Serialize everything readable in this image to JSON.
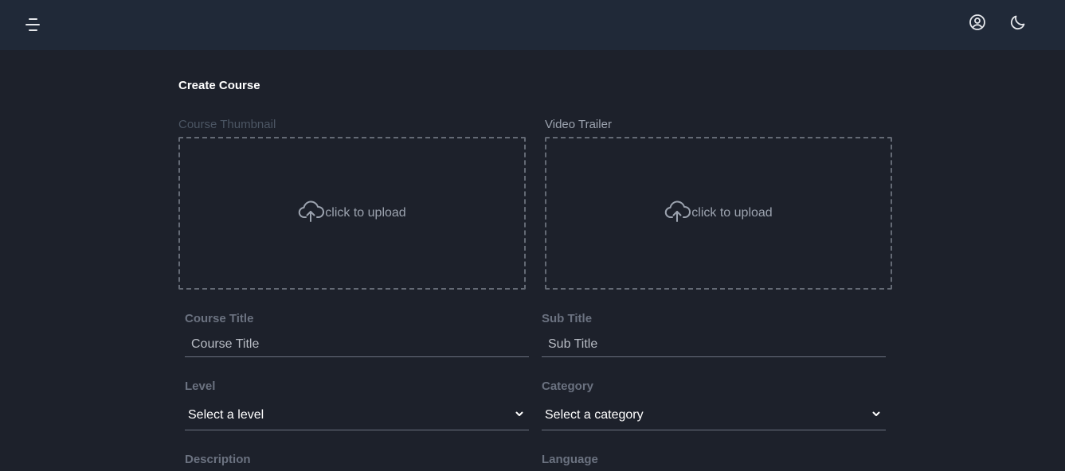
{
  "header": {
    "menu_icon": "menu-lines-icon",
    "profile_icon": "user-circle-icon",
    "theme_icon": "moon-icon"
  },
  "page": {
    "title": "Create Course"
  },
  "uploads": {
    "thumbnail": {
      "label": "Course Thumbnail",
      "cta": "click to upload",
      "icon": "cloud-upload-icon",
      "label_color": "#4b5563"
    },
    "trailer": {
      "label": "Video Trailer",
      "cta": "click to upload",
      "icon": "cloud-upload-icon",
      "label_color": "#9ca3af"
    }
  },
  "fields": {
    "course_title": {
      "label": "Course Title",
      "placeholder": "Course Title"
    },
    "sub_title": {
      "label": "Sub Title",
      "placeholder": "Sub Title"
    },
    "level": {
      "label": "Level",
      "selected": "Select a level"
    },
    "category": {
      "label": "Category",
      "selected": "Select a category"
    },
    "description": {
      "label": "Description"
    },
    "language": {
      "label": "Language"
    }
  }
}
